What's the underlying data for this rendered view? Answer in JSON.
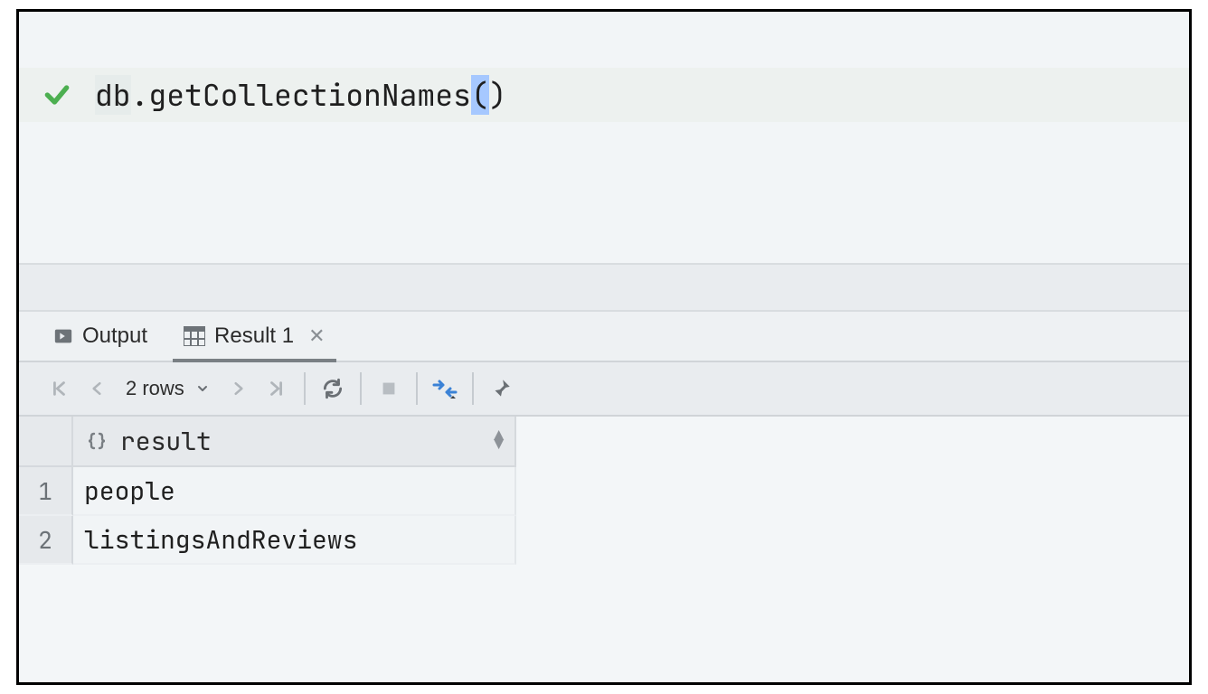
{
  "editor": {
    "db_prefix": "db",
    "dot": ".",
    "method": "getCollectionNames",
    "open": "(",
    "close": ")"
  },
  "tabs": {
    "output": "Output",
    "result_label": "Result 1"
  },
  "toolbar": {
    "row_count": "2 rows"
  },
  "results": {
    "column_header": "result",
    "rows": [
      {
        "n": "1",
        "v": "people"
      },
      {
        "n": "2",
        "v": "listingsAndReviews"
      }
    ]
  }
}
